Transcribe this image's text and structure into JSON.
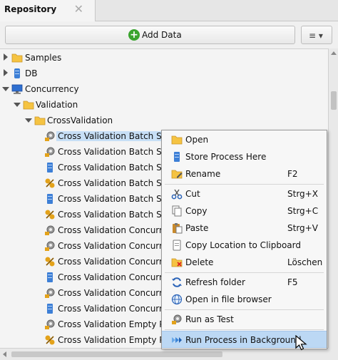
{
  "tab": {
    "title": "Repository",
    "close": "✕"
  },
  "toolbar": {
    "add_data_label": "Add Data",
    "add_icon_glyph": "+",
    "menu_glyph": "≡ ▾"
  },
  "tree": [
    {
      "label": "Samples",
      "icon": "folder-icon"
    },
    {
      "label": "DB",
      "icon": "database-icon"
    },
    {
      "label": "Concurrency",
      "icon": "computer-icon"
    },
    {
      "label": "Validation",
      "icon": "folder-icon"
    },
    {
      "label": "CrossValidation",
      "icon": "folder-icon"
    },
    {
      "label": "Cross Validation Batch Split",
      "icon": "process-icon",
      "selected": true
    },
    {
      "label": "Cross Validation Batch Split E",
      "icon": "process-icon"
    },
    {
      "label": "Cross Validation Batch Split E",
      "icon": "data-table-icon"
    },
    {
      "label": "Cross Validation Batch Split-",
      "icon": "model-icon"
    },
    {
      "label": "Cross Validation Batch Split-s",
      "icon": "data-table-icon"
    },
    {
      "label": "Cross Validation Batch Split-s",
      "icon": "model-icon"
    },
    {
      "label": "Cross Validation Concurrenc",
      "icon": "process-icon"
    },
    {
      "label": "Cross Validation Concurrenc",
      "icon": "process-icon"
    },
    {
      "label": "Cross Validation Concurrenc",
      "icon": "model-icon"
    },
    {
      "label": "Cross Validation Concurrenc",
      "icon": "data-table-icon"
    },
    {
      "label": "Cross Validation Concurrent",
      "icon": "process-icon"
    },
    {
      "label": "Cross Validation Concurrent",
      "icon": "data-table-icon"
    },
    {
      "label": "Cross Validation Empty Perfo",
      "icon": "process-icon"
    },
    {
      "label": "Cross Validation Empty Perfo",
      "icon": "model-icon"
    }
  ],
  "context_menu": {
    "open": {
      "label": "Open",
      "accel": ""
    },
    "store": {
      "label": "Store Process Here",
      "accel": ""
    },
    "rename": {
      "label": "Rename",
      "accel": "F2"
    },
    "cut": {
      "label": "Cut",
      "accel": "Strg+X"
    },
    "copy": {
      "label": "Copy",
      "accel": "Strg+C"
    },
    "paste": {
      "label": "Paste",
      "accel": "Strg+V"
    },
    "copy_location": {
      "label": "Copy Location to Clipboard",
      "accel": ""
    },
    "delete": {
      "label": "Delete",
      "accel": "Löschen"
    },
    "refresh": {
      "label": "Refresh folder",
      "accel": "F5"
    },
    "open_browser": {
      "label": "Open in file browser",
      "accel": ""
    },
    "run_test": {
      "label": "Run as Test",
      "accel": ""
    },
    "run_background": {
      "label": "Run Process in Background",
      "accel": ""
    }
  },
  "colors": {
    "accent": "#3aa42e",
    "highlight": "#bcd8f4",
    "selection": "#c7dff6",
    "folder": "#f5c342"
  }
}
